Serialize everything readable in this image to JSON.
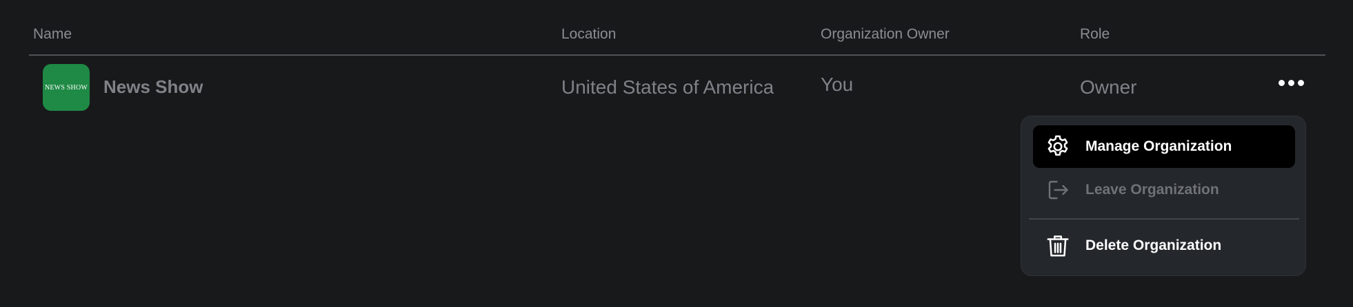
{
  "table": {
    "headers": {
      "name": "Name",
      "location": "Location",
      "owner": "Organization Owner",
      "role": "Role"
    },
    "rows": [
      {
        "logo_text": "NEWS SHOW",
        "logo_color": "#1e8a45",
        "name": "News Show",
        "location": "United States of America",
        "owner": "You",
        "role": "Owner"
      }
    ]
  },
  "menu": {
    "items": [
      {
        "label": "Manage Organization",
        "icon": "gear-icon",
        "state": "highlighted"
      },
      {
        "label": "Leave Organization",
        "icon": "exit-icon",
        "state": "disabled"
      },
      {
        "label": "Delete Organization",
        "icon": "trash-icon",
        "state": "normal"
      }
    ]
  },
  "colors": {
    "background": "#18191b",
    "menu_background": "#24272b",
    "highlight": "#000000",
    "muted_text": "#7f8287"
  }
}
